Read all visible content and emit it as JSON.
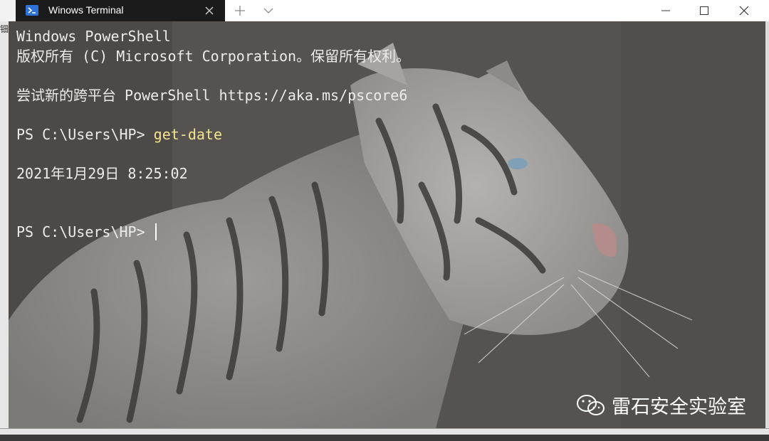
{
  "window": {
    "tab_title": "Winows Terminal"
  },
  "terminal": {
    "line1": "Windows PowerShell",
    "line2": "版权所有 (C) Microsoft Corporation。保留所有权利。",
    "line3": "尝试新的跨平台 PowerShell https://aka.ms/pscore6",
    "prompt": "PS C:\\Users\\HP> ",
    "command": "get-date",
    "output": "2021年1月29日 8:25:02"
  },
  "watermark": {
    "text": "雷石安全实验室"
  },
  "edge_text": "钿",
  "colors": {
    "tab_bg": "#1b1b1b",
    "command": "#f3e48f",
    "terminal_text": "#ececec"
  }
}
